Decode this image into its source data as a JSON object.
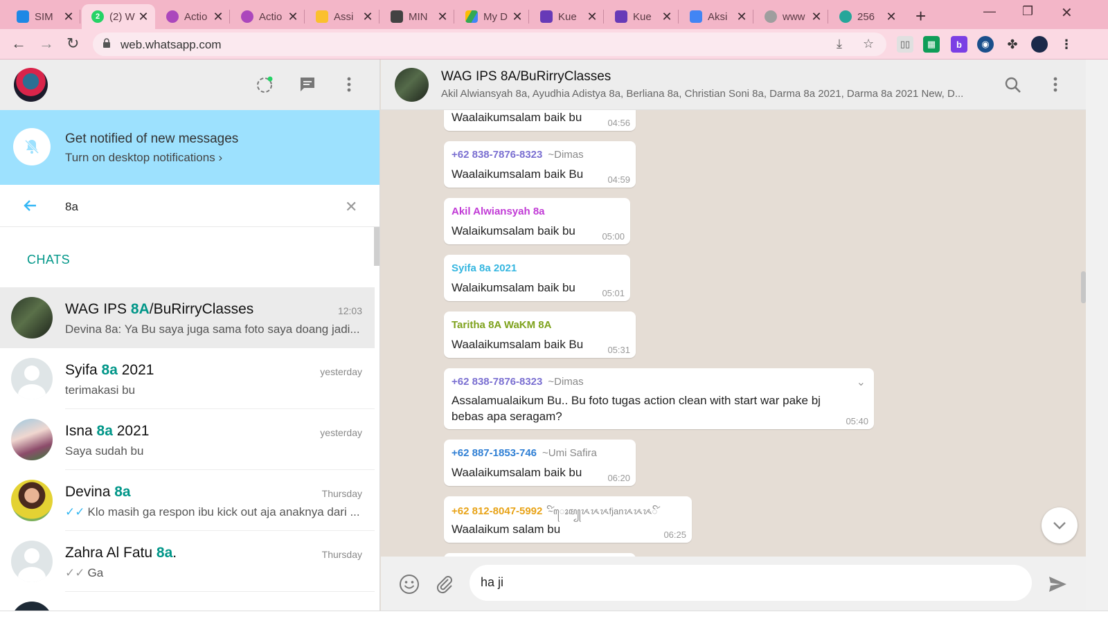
{
  "browser": {
    "tabs": [
      {
        "title": "SIM",
        "favicon_color": "#1e88e5"
      },
      {
        "title": "(2) W",
        "favicon_color": "#25d366"
      },
      {
        "title": "Actio",
        "favicon_color": "#ab47bc"
      },
      {
        "title": "Actio",
        "favicon_color": "#ab47bc"
      },
      {
        "title": "Assi",
        "favicon_color": "#fbc02d"
      },
      {
        "title": "MIN",
        "favicon_color": "#424242"
      },
      {
        "title": "My D",
        "favicon_color": "#34a853"
      },
      {
        "title": "Kue",
        "favicon_color": "#673ab7"
      },
      {
        "title": "Kue",
        "favicon_color": "#673ab7"
      },
      {
        "title": "Aksi",
        "favicon_color": "#4285f4"
      },
      {
        "title": "www",
        "favicon_color": "#9e9e9e"
      },
      {
        "title": "256",
        "favicon_color": "#26a69a"
      }
    ],
    "url": "web.whatsapp.com"
  },
  "sidebar": {
    "notification": {
      "title": "Get notified of new messages",
      "action": "Turn on desktop notifications ›"
    },
    "search_query": "8a",
    "section_label": "CHATS",
    "chats": [
      {
        "name_pre": "WAG IPS ",
        "name_hl": "8A",
        "name_post": "/BuRirryClasses",
        "time": "12:03",
        "preview": "Devina 8a: Ya Bu saya juga sama foto saya doang  jadi...",
        "ticks": ""
      },
      {
        "name_pre": "Syifa ",
        "name_hl": "8a",
        "name_post": " 2021",
        "time": "yesterday",
        "preview": "terimakasi bu",
        "ticks": ""
      },
      {
        "name_pre": "Isna ",
        "name_hl": "8a",
        "name_post": " 2021",
        "time": "yesterday",
        "preview": "Saya sudah bu",
        "ticks": ""
      },
      {
        "name_pre": "Devina ",
        "name_hl": "8a",
        "name_post": "",
        "time": "Thursday",
        "preview": "Klo masih ga respon ibu kick out aja anaknya dari ...",
        "ticks": "✓✓"
      },
      {
        "name_pre": "Zahra Al Fatu ",
        "name_hl": "8a",
        "name_post": ".",
        "time": "Thursday",
        "preview": "Ga",
        "ticks": "✓✓"
      }
    ]
  },
  "conversation": {
    "title": "WAG IPS 8A/BuRirryClasses",
    "members": "Akil Alwiansyah 8a, Ayudhia Adistya 8a, Berliana 8a, Christian Soni 8a, Darma 8a 2021, Darma 8a 2021 New, D...",
    "messages": [
      {
        "sender": "",
        "nick": "",
        "color": "#000000",
        "text": "Waalaikumsalam baik bu",
        "time": "04:56"
      },
      {
        "sender": "+62 838-7876-8323",
        "nick": "~Dimas",
        "color": "#7a6fd1",
        "text": "Waalaikumsalam baik Bu",
        "time": "04:59"
      },
      {
        "sender": "Akil Alwiansyah 8a",
        "nick": "",
        "color": "#c13bd6",
        "text": "Walaikumsalam baik bu",
        "time": "05:00"
      },
      {
        "sender": "Syifa 8a 2021",
        "nick": "",
        "color": "#35b6e0",
        "text": "Walaikumsalam baik bu",
        "time": "05:01"
      },
      {
        "sender": "Taritha 8A WaKM 8A",
        "nick": "",
        "color": "#7ea21c",
        "text": "Waalaikumsalam baik Bu",
        "time": "05:31"
      },
      {
        "sender": "+62 838-7876-8323",
        "nick": "~Dimas",
        "color": "#7a6fd1",
        "text": "Assalamualaikum Bu.. Bu foto tugas action clean with start war pake bj bebas apa seragam?",
        "time": "05:40"
      },
      {
        "sender": "+62 887-1853-746",
        "nick": "~Umi Safira",
        "color": "#2f7fd4",
        "text": "Waalaikumsalam baik bu",
        "time": "06:20"
      },
      {
        "sender": "+62 812-8047-5992",
        "nick": "~ꦼꦂꦺꦴꦩ꧀ᝰᝰᝰfjanᝰᝰᝰꦼꦂ",
        "color": "#e8a317",
        "text": "Waalaikum salam bu",
        "time": "06:25"
      }
    ],
    "composer_text": "ha ji"
  }
}
